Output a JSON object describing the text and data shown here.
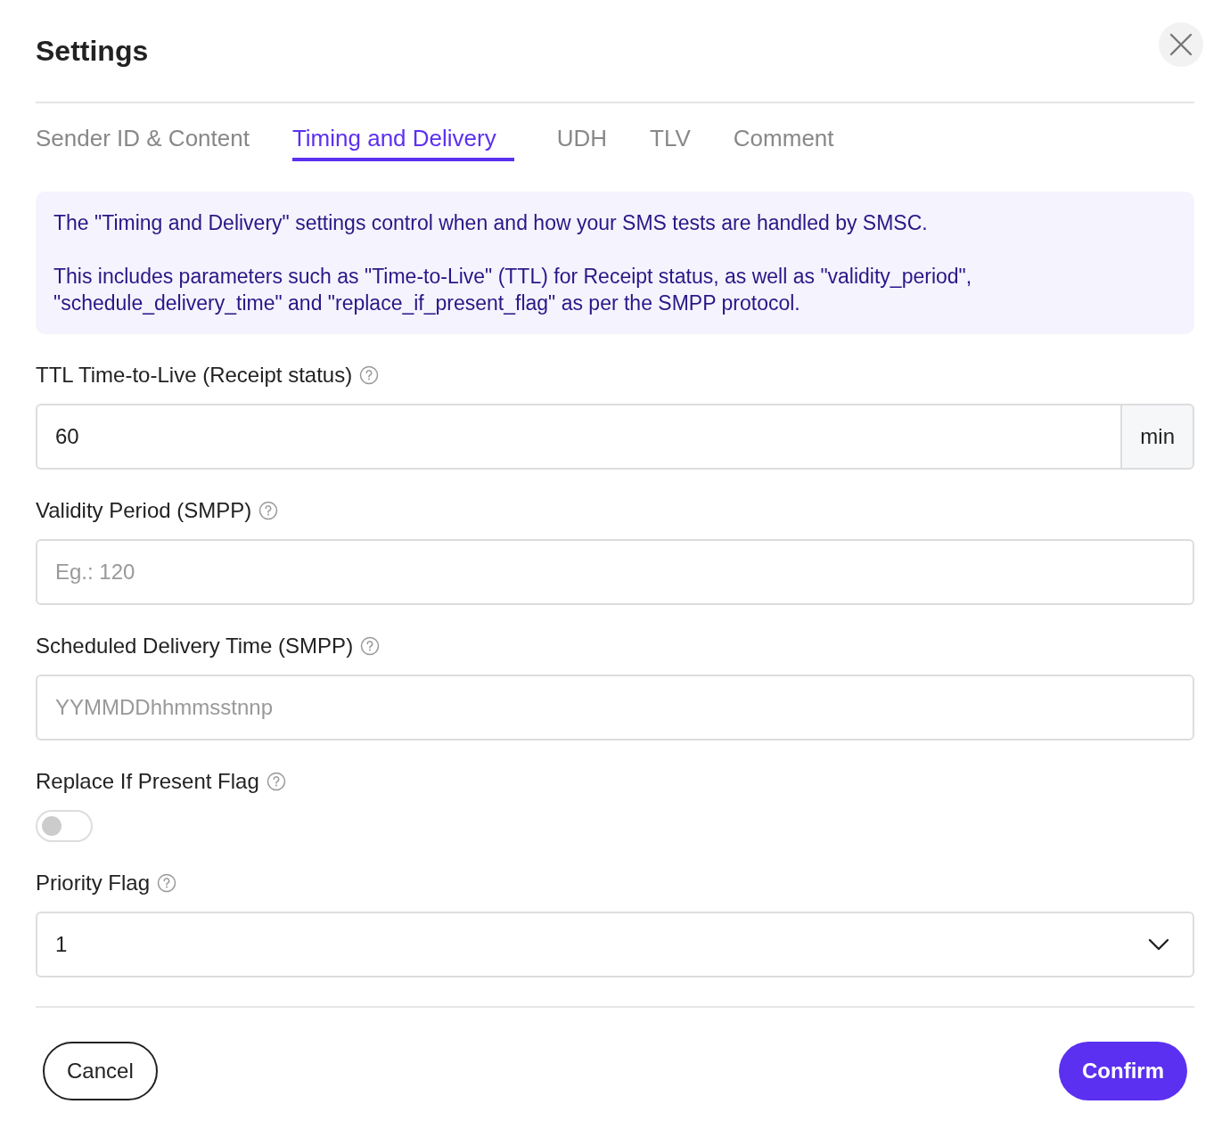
{
  "dialog": {
    "title": "Settings"
  },
  "tabs": [
    {
      "label": "Sender ID & Content",
      "selected": false
    },
    {
      "label": "Timing and Delivery",
      "selected": true
    },
    {
      "label": "UDH",
      "selected": false
    },
    {
      "label": "TLV",
      "selected": false
    },
    {
      "label": "Comment",
      "selected": false
    }
  ],
  "info": [
    "The \"Timing and Delivery\" settings control when and how your SMS tests are handled by SMSC.",
    "This includes parameters such as \"Time-to-Live\" (TTL) for Receipt status, as well as \"validity_period\", \"schedule_delivery_time\" and \"replace_if_present_flag\" as per the SMPP protocol."
  ],
  "fields": [
    {
      "kind": "input",
      "label": "TTL Time-to-Live (Receipt status)",
      "value": "60",
      "suffix": "min"
    },
    {
      "kind": "input",
      "label": "Validity Period (SMPP)",
      "placeholder": "Eg.: 120"
    },
    {
      "kind": "input",
      "label": "Scheduled Delivery Time (SMPP)",
      "placeholder": "YYMMDDhhmmsstnnp"
    },
    {
      "kind": "toggle",
      "label": "Replace If Present Flag",
      "on": false
    },
    {
      "kind": "select",
      "label": "Priority Flag",
      "value": "1"
    }
  ],
  "buttons": {
    "cancel": "Cancel",
    "confirm": "Confirm"
  }
}
